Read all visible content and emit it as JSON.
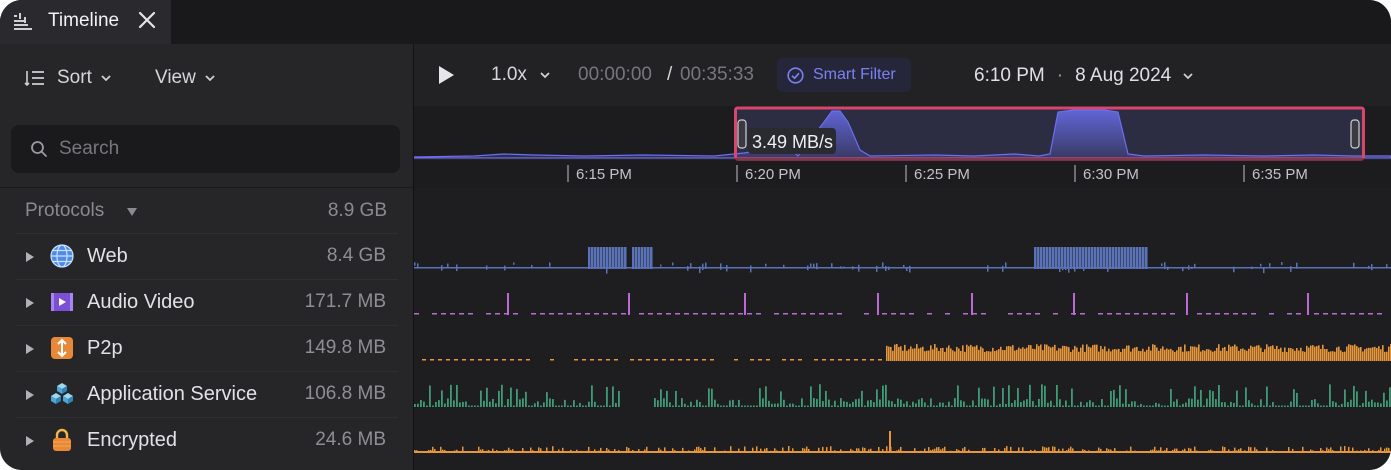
{
  "tab": {
    "title": "Timeline",
    "icon": "timeline-icon",
    "close_icon": "close-icon"
  },
  "left_toolbar": {
    "sort_label": "Sort",
    "view_label": "View"
  },
  "search": {
    "placeholder": "Search",
    "value": ""
  },
  "protocols": {
    "header": "Protocols",
    "total": "8.9 GB",
    "items": [
      {
        "label": "Web",
        "size": "8.4 GB",
        "icon": "globe-icon",
        "color": "#5a73b8"
      },
      {
        "label": "Audio Video",
        "size": "171.7 MB",
        "icon": "video-icon",
        "color": "#b96ad6"
      },
      {
        "label": "P2p",
        "size": "149.8 MB",
        "icon": "p2p-icon",
        "color": "#e8963a"
      },
      {
        "label": "Application Service",
        "size": "106.8 MB",
        "icon": "cubes-icon",
        "color": "#3f9b76"
      },
      {
        "label": "Encrypted",
        "size": "24.6 MB",
        "icon": "lock-icon",
        "color": "#e8963a"
      }
    ]
  },
  "playback": {
    "speed": "1.0x",
    "current_time": "00:00:00",
    "separator": "/",
    "total_time": "00:35:33",
    "smart_filter": "Smart Filter",
    "clock_time": "6:10 PM",
    "clock_sep": "·",
    "clock_date": "8 Aug 2024"
  },
  "overview": {
    "rate_label": "3.49 MB/s",
    "ticks": [
      "6:15 PM",
      "6:20 PM",
      "6:25 PM",
      "6:30 PM",
      "6:35 PM"
    ],
    "accent_color": "#6b6ff0",
    "selection_color": "#d9466b"
  }
}
